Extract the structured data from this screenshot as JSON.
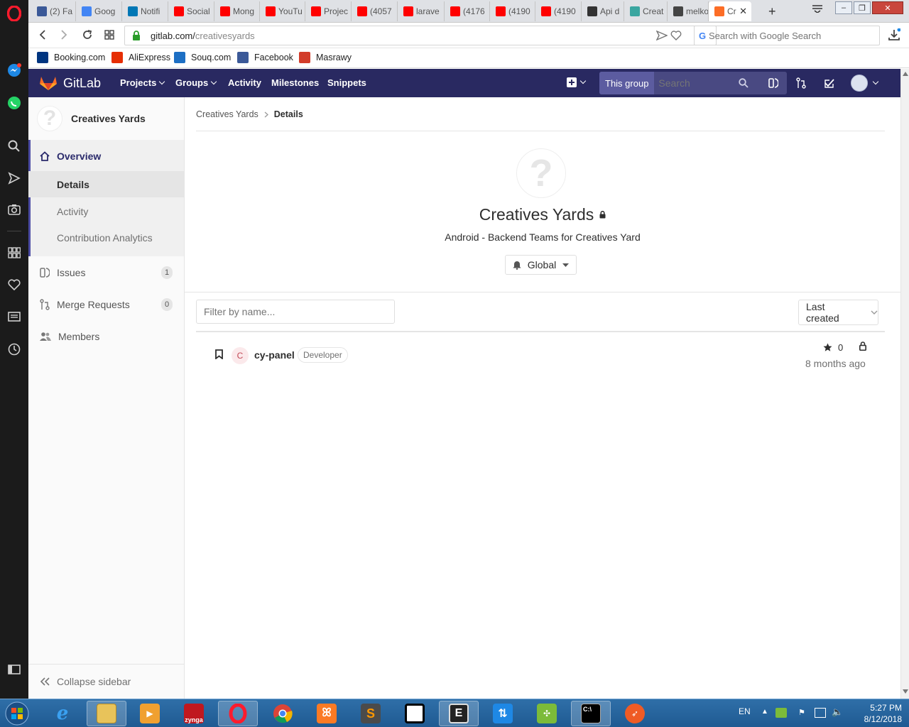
{
  "browser": {
    "tabs": [
      {
        "label": "(2) Fa",
        "icon": "facebook-icon",
        "color": "#3b5998"
      },
      {
        "label": "Goog",
        "icon": "google-translate-icon",
        "color": "#4285f4"
      },
      {
        "label": "Notifi",
        "icon": "linkedin-icon",
        "color": "#0077b5"
      },
      {
        "label": "Social",
        "icon": "youtube-icon",
        "color": "#ff0000"
      },
      {
        "label": "Mong",
        "icon": "youtube-icon",
        "color": "#ff0000"
      },
      {
        "label": "YouTu",
        "icon": "youtube-icon",
        "color": "#ff0000"
      },
      {
        "label": "Projec",
        "icon": "youtube-icon",
        "color": "#ff0000"
      },
      {
        "label": "(4057",
        "icon": "youtube-icon",
        "color": "#ff0000"
      },
      {
        "label": "larave",
        "icon": "youtube-icon",
        "color": "#ff0000"
      },
      {
        "label": "(4176",
        "icon": "youtube-icon",
        "color": "#ff0000"
      },
      {
        "label": "(4190",
        "icon": "youtube-icon",
        "color": "#ff0000"
      },
      {
        "label": "(4190",
        "icon": "youtube-icon",
        "color": "#ff0000"
      },
      {
        "label": "Api d",
        "icon": "document-icon",
        "color": "#333333"
      },
      {
        "label": "Creat",
        "icon": "shirt-icon",
        "color": "#3aa6a0"
      },
      {
        "label": "melko",
        "icon": "slack-icon",
        "color": "#444444"
      },
      {
        "label": "Cr",
        "icon": "gitlab-icon",
        "color": "#fc6d26"
      }
    ],
    "url_domain": "gitlab.com/",
    "url_path": "creativesyards",
    "search_placeholder": "Search with Google Search",
    "bookmarks": [
      {
        "label": "Booking.com",
        "icon": "booking-icon",
        "color": "#003580"
      },
      {
        "label": "AliExpress",
        "icon": "aliexpress-icon",
        "color": "#e62e04"
      },
      {
        "label": "Souq.com",
        "icon": "souq-icon",
        "color": "#1d6fc4"
      },
      {
        "label": "Facebook",
        "icon": "facebook-icon",
        "color": "#3b5998"
      },
      {
        "label": "Masrawy",
        "icon": "masrawy-icon",
        "color": "#d23c2a"
      }
    ]
  },
  "header": {
    "brand": "GitLab",
    "nav": [
      "Projects",
      "Groups",
      "Activity",
      "Milestones",
      "Snippets"
    ],
    "scope_label": "This group",
    "search_placeholder": "Search"
  },
  "sidebar": {
    "group_name": "Creatives Yards",
    "overview_label": "Overview",
    "overview_items": [
      "Details",
      "Activity",
      "Contribution Analytics"
    ],
    "issues_label": "Issues",
    "issues_count": "1",
    "merge_requests_label": "Merge Requests",
    "merge_requests_count": "0",
    "members_label": "Members",
    "collapse_label": "Collapse sidebar"
  },
  "content": {
    "breadcrumb_root": "Creatives Yards",
    "breadcrumb_current": "Details",
    "group_title": "Creatives Yards",
    "group_description": "Android - Backend Teams for Creatives Yard",
    "notification_label": "Global",
    "filter_placeholder": "Filter by name...",
    "sort_label": "Last created",
    "projects": [
      {
        "avatar_letter": "C",
        "name": "cy-panel",
        "role": "Developer",
        "stars": "0",
        "updated": "8 months ago"
      }
    ]
  },
  "taskbar": {
    "apps": [
      "start-orb",
      "internet-explorer",
      "file-explorer",
      "media-player",
      "zynga",
      "opera",
      "chrome",
      "xampp",
      "sublime-text",
      "intellij",
      "editor",
      "filezilla",
      "git-tool",
      "command-prompt",
      "postman"
    ],
    "zynga_label": "zynga",
    "language": "EN",
    "time": "5:27 PM",
    "date": "8/12/2018"
  },
  "colors": {
    "gitlab_header": "#292961",
    "gitlab_accent": "#4b4ba3",
    "opera_red": "#ff1b2d"
  }
}
